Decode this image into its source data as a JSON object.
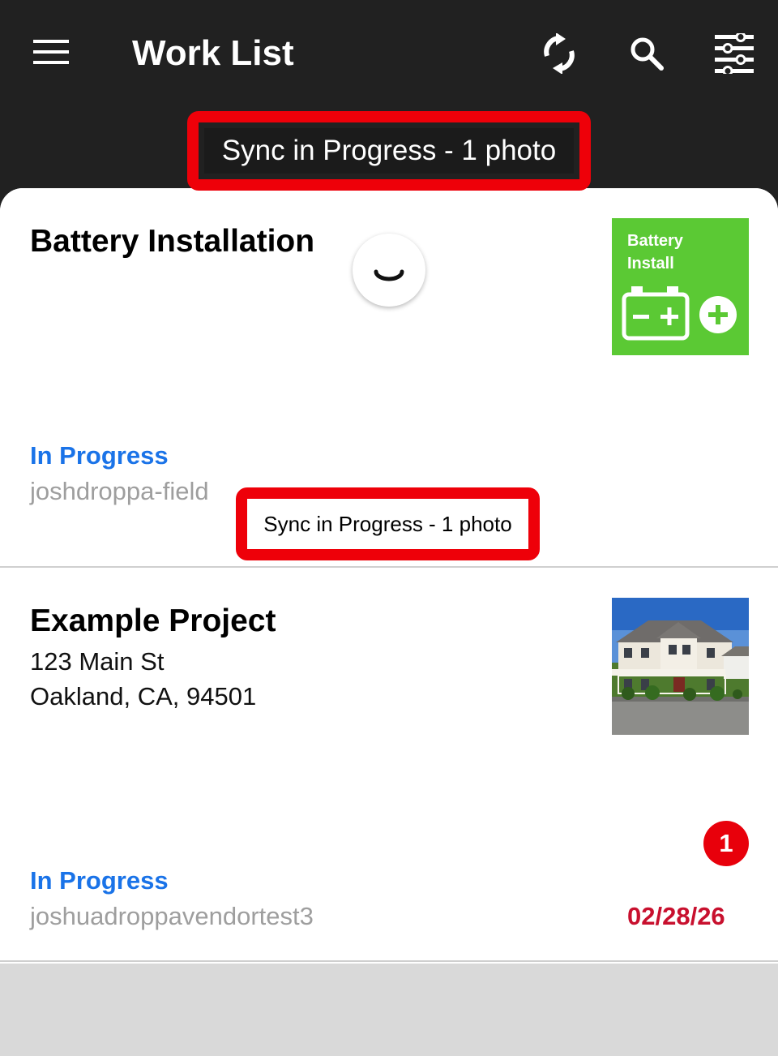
{
  "app_bar": {
    "title": "Work List",
    "menu_icon": "hamburger-menu-icon",
    "sync_icon": "sync-icon",
    "search_icon": "search-icon",
    "filter_icon": "filter-sliders-icon",
    "background": "#212121"
  },
  "sync_banner": {
    "text": "Sync in Progress - 1 photo",
    "highlight_color": "#ee0009"
  },
  "cards": [
    {
      "title": "Battery Installation",
      "thumbnail_text": [
        "Battery",
        "Install"
      ],
      "thumbnail_color": "#5bc934",
      "thumbnail_icon": "battery-plus-icon",
      "status": "In Progress",
      "user": "joshdroppa-field",
      "loading_spinner": "spinner-icon",
      "sync_toast": "Sync in Progress - 1 photo"
    },
    {
      "title": "Example Project",
      "address_line1": "123 Main St",
      "address_line2": "Oakland, CA, 94501",
      "thumbnail": "house-photo",
      "status": "In Progress",
      "user": "joshuadroppavendortest3",
      "badge_count": "1",
      "due_date": "02/28/26"
    }
  ],
  "colors": {
    "status": "#1a73e8",
    "due_date": "#c8102e",
    "badge": "#e8000b"
  }
}
